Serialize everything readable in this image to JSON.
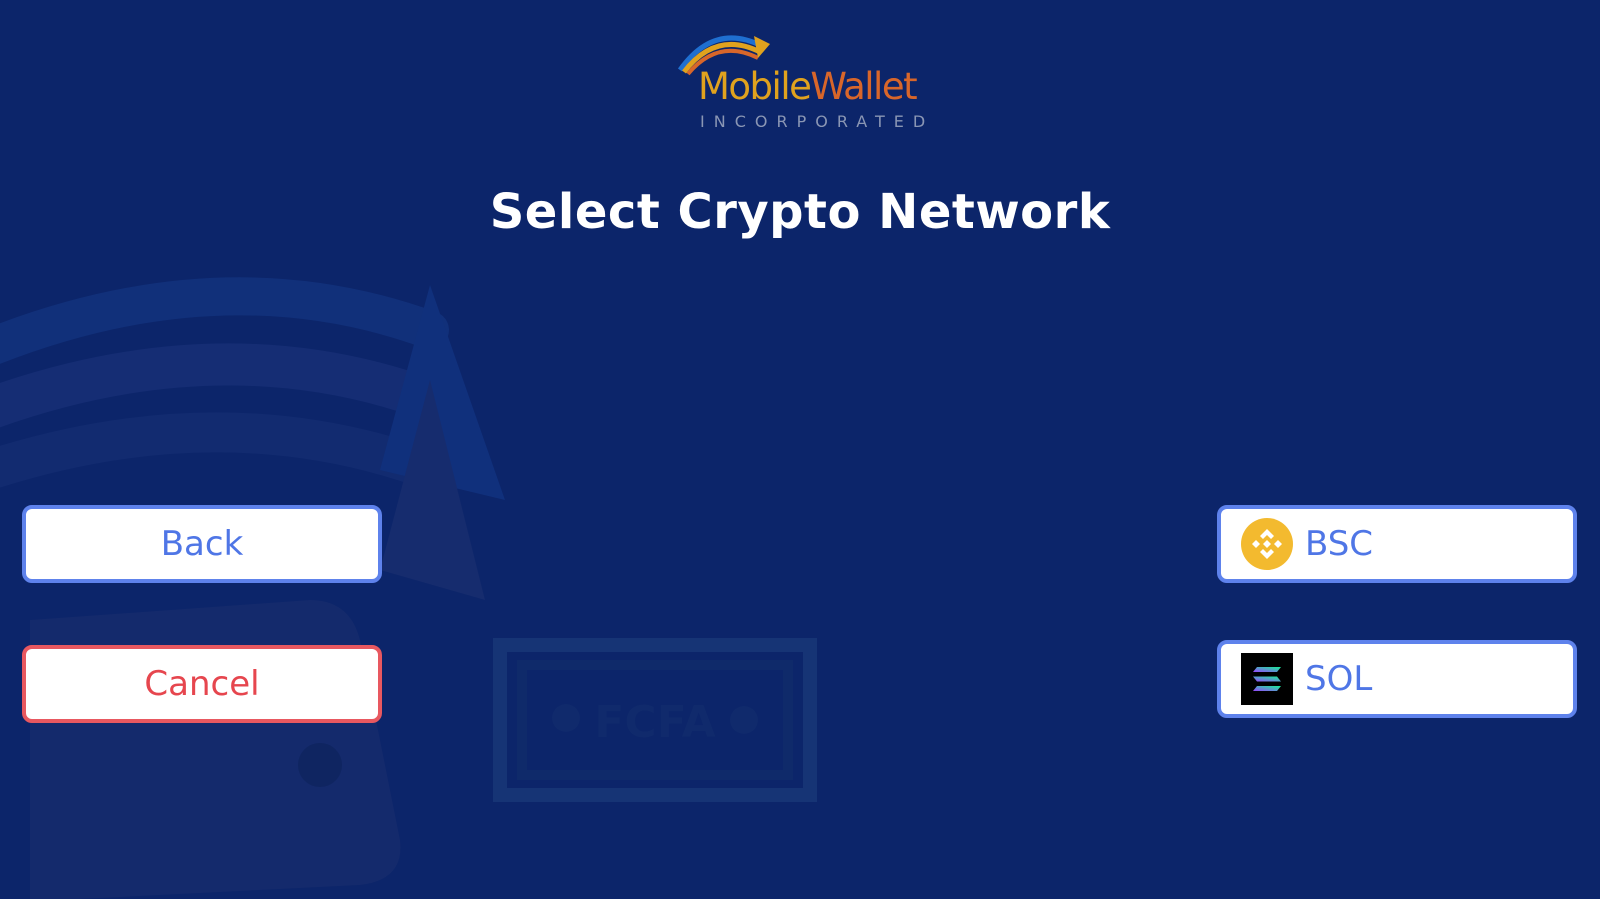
{
  "logo": {
    "brand_first": "Mobile",
    "brand_second": "Wallet",
    "subtitle": "INCORPORATED"
  },
  "page": {
    "title": "Select Crypto Network"
  },
  "actions": {
    "back_label": "Back",
    "cancel_label": "Cancel"
  },
  "networks": [
    {
      "label": "BSC",
      "icon": "bnb-icon"
    },
    {
      "label": "SOL",
      "icon": "solana-icon"
    }
  ],
  "watermark": {
    "currency_label": "FCFA"
  },
  "colors": {
    "background": "#0c256a",
    "primary_border": "#5e82ec",
    "primary_text": "#4f76e6",
    "cancel_border": "#e85860",
    "cancel_text": "#e6464e",
    "bnb_yellow": "#f3ba2f"
  }
}
